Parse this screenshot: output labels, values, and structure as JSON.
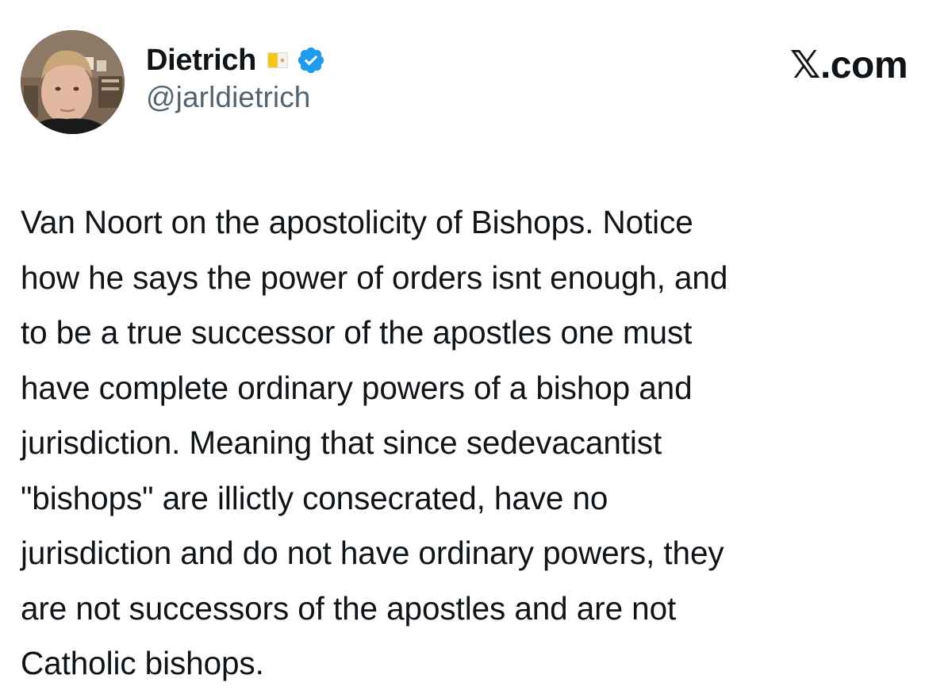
{
  "author": {
    "display_name": "Dietrich",
    "handle": "@jarldietrich",
    "flag_icon": "vatican-flag-icon",
    "verified_icon": "verified-badge-icon",
    "verified_color": "#1d9bf0"
  },
  "site": {
    "label": "𝕏.com"
  },
  "tweet": {
    "text": "Van Noort on the apostolicity of Bishops. Notice\nhow he says the power of orders isnt enough, and\nto be a true successor of the apostles one must\nhave complete ordinary powers of a bishop and\njurisdiction. Meaning that since sedevacantist\n\"bishops\" are illictly consecrated, have no\njurisdiction and do not have ordinary powers, they\nare not successors of the apostles and are not\nCatholic bishops."
  },
  "colors": {
    "text": "#0f1419",
    "secondary": "#536471",
    "background": "#ffffff"
  }
}
